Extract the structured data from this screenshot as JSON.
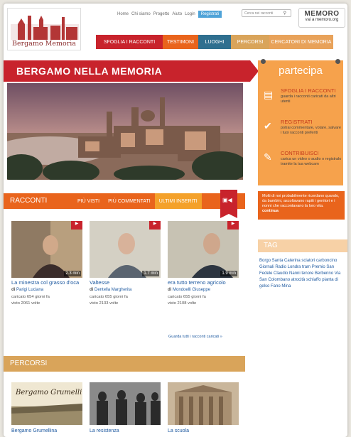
{
  "header": {
    "logo_text": "Bergamo Memoria",
    "top_links": [
      "Home",
      "Chi siamo",
      "Progetto",
      "Aiuto",
      "Login"
    ],
    "register_label": "Registrati",
    "search_placeholder": "Cerca nei racconti",
    "memoro_logo": "MEMORO",
    "memoro_url": "vai a memoro.org"
  },
  "main_nav": [
    {
      "label": "SFOGLIA I RACCONTI",
      "color": "#c8232c"
    },
    {
      "label": "TESTIMONI",
      "color": "#e9641c"
    },
    {
      "label": "LUOGHI",
      "color": "#2f6f8f"
    },
    {
      "label": "PERCORSI",
      "color": "#d9a45a"
    },
    {
      "label": "CERCATORI DI MEMORIA",
      "color": "#e8a25a"
    }
  ],
  "banner": {
    "title": "BERGAMO NELLA MEMORIA"
  },
  "racconti": {
    "title": "RACCONTI",
    "tabs": [
      "PIÙ VISTI",
      "PIÙ COMMENTATI",
      "ULTIMI INSERITI"
    ],
    "items": [
      {
        "duration": "2.3 min",
        "title": "La minestra col grasso d'oca",
        "author_prefix": "di",
        "author": "Parigi Luciana",
        "uploaded": "caricato 654 giorni fa",
        "views": "visto 2061 volte"
      },
      {
        "duration": "1.7 min",
        "title": "Valtesse",
        "author_prefix": "di",
        "author": "Dentella Margherita",
        "uploaded": "caricato 655 giorni fa",
        "views": "visto 2133 volte"
      },
      {
        "duration": "1.9 min",
        "title": "era tutto terreno agricolo",
        "author_prefix": "di",
        "author": "Mondoelli Giuseppe",
        "uploaded": "caricato 655 giorni fa",
        "views": "visto 2108 volte"
      }
    ],
    "see_all": "Guarda tutti i racconti caricati »"
  },
  "percorsi": {
    "title": "PERCORSI",
    "items": [
      {
        "label": "Bergamo Grumellina",
        "image_text": "Bergamo Grumellina"
      },
      {
        "label": "La resistenza"
      },
      {
        "label": "La scuola"
      }
    ]
  },
  "partecipa": {
    "title": "partecipa",
    "items": [
      {
        "icon": "book-icon",
        "title": "SFOGLIA I RACCONTI",
        "desc": "guarda i racconti caricati da altri utenti"
      },
      {
        "icon": "check-icon",
        "title": "REGISTRATI",
        "desc": "potrai commentare, votare, salvare i tuoi racconti preferiti"
      },
      {
        "icon": "pencil-icon",
        "title": "CONTRIBUISCI",
        "desc": "carica un video o audio o registralo tramite la tua webcam"
      }
    ]
  },
  "quote": {
    "text": "Molti di noi probabilmente ricordano quando, da bambini, ascoltavano rapiti i genitori e i nonni che raccontavano la loro vita.",
    "continue_label": "continua"
  },
  "tags": {
    "title": "TAG",
    "cloud": "Borgo Santa Caterina sciatori carboncino Giornali Radio Londra tram Premio San Fedele Claudio Nanni tenore Berbenno Via San Colombano atrocità schiaffo pianta di gelso Fano Mina"
  }
}
